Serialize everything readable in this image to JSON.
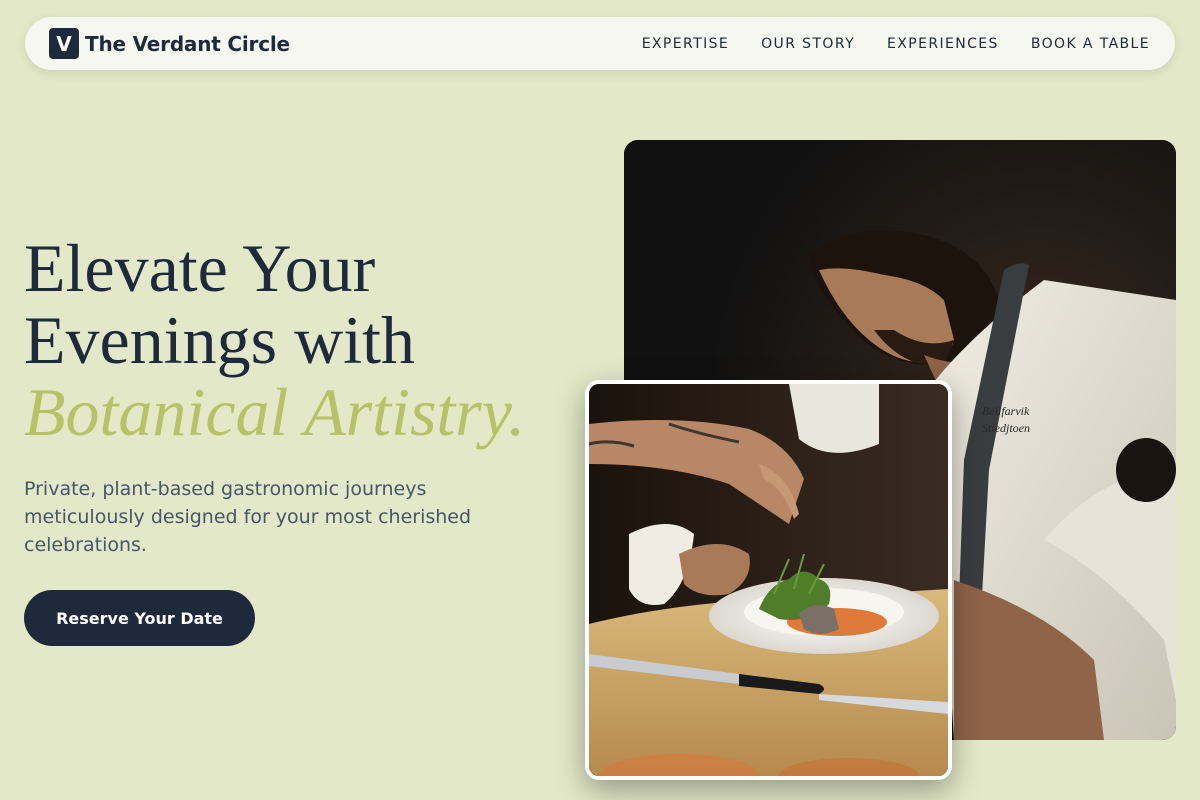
{
  "nav": {
    "logo_letter": "V",
    "brand_name": "The Verdant Circle",
    "links": [
      {
        "label": "EXPERTISE"
      },
      {
        "label": "OUR STORY"
      },
      {
        "label": "EXPERIENCES"
      },
      {
        "label": "BOOK A TABLE"
      }
    ]
  },
  "hero": {
    "headline_line1": "Elevate Your",
    "headline_line2": "Evenings with",
    "headline_accent": "Botanical Artistry.",
    "subtitle": "Private, plant-based gastronomic journeys meticulously designed for your most cherished celebrations.",
    "cta_label": "Reserve Your Date"
  },
  "images": {
    "main_photo": "chef-plating-photo",
    "inset_photo": "plated-dish-closeup-photo"
  },
  "colors": {
    "background": "#e3e8c8",
    "navy": "#1e293b",
    "accent": "#b6c265"
  }
}
